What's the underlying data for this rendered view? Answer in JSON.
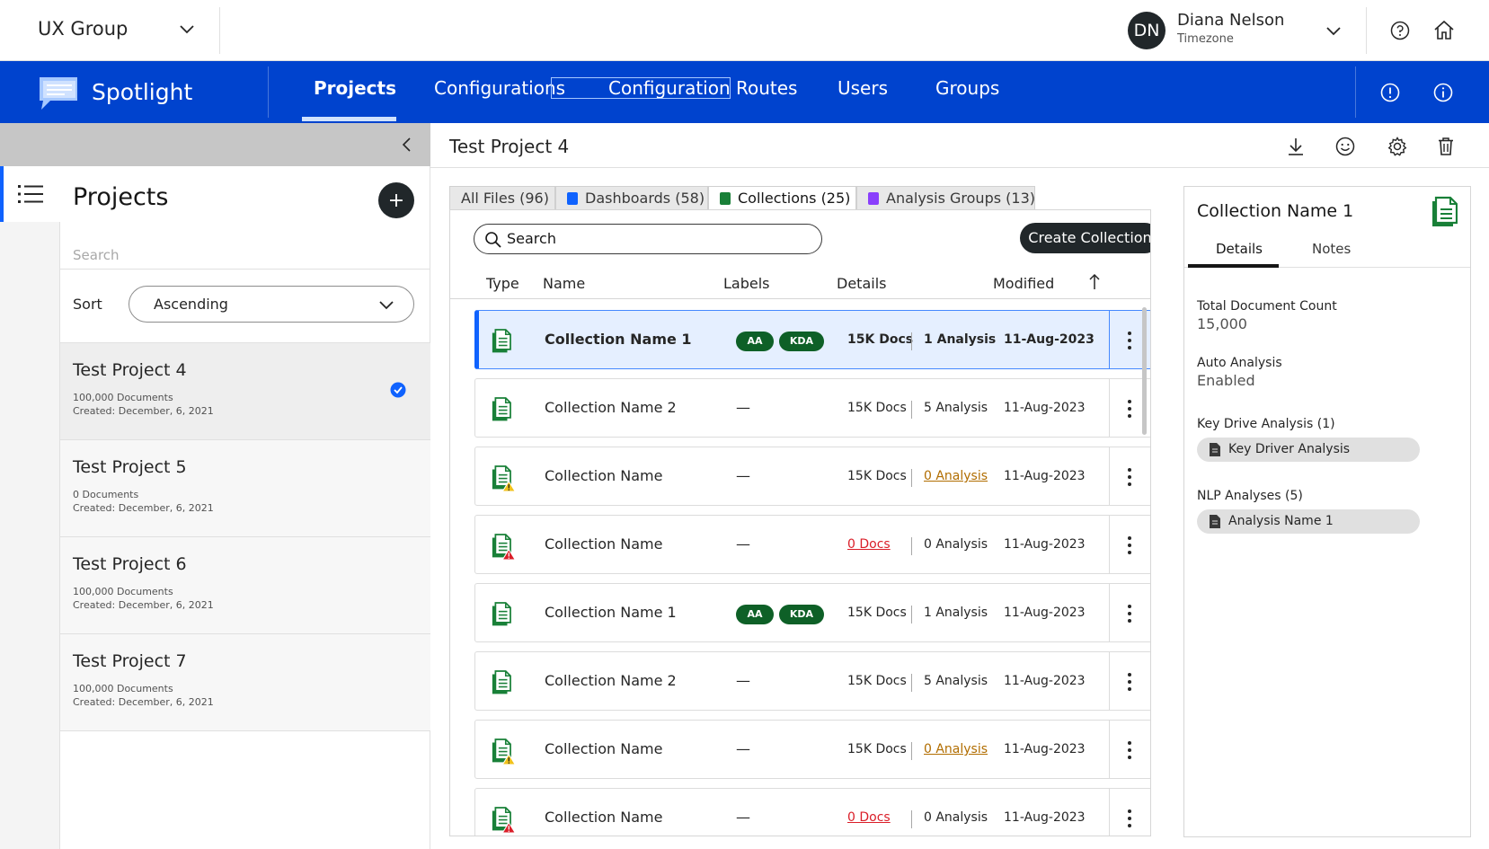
{
  "header": {
    "org_name": "UX Group",
    "user": {
      "initials": "DN",
      "name": "Diana Nelson",
      "subtitle": "Timezone"
    }
  },
  "nav": {
    "brand": "Spotlight",
    "items": [
      {
        "label": "Projects",
        "active": true
      },
      {
        "label": "Configurations"
      },
      {
        "label": "Configuration Routes"
      },
      {
        "label": "Users"
      },
      {
        "label": "Groups"
      }
    ]
  },
  "projects_panel": {
    "title": "Projects",
    "add_label": "+",
    "search_placeholder": "Search",
    "sort_label": "Sort",
    "sort_value": "Ascending",
    "items": [
      {
        "name": "Test Project 4",
        "docs": "100,000 Documents",
        "created": "Created: December, 6, 2021",
        "selected": true
      },
      {
        "name": "Test Project 5",
        "docs": "0 Documents",
        "created": "Created: December, 6, 2021"
      },
      {
        "name": "Test Project 6",
        "docs": "100,000 Documents",
        "created": "Created: December, 6, 2021"
      },
      {
        "name": "Test Project 7",
        "docs": "100,000 Documents",
        "created": "Created: December, 6, 2021"
      }
    ]
  },
  "main": {
    "title": "Test Project 4",
    "tabs": [
      {
        "label": "All Files (96)"
      },
      {
        "label": "Dashboards (58)"
      },
      {
        "label": "Collections (25)",
        "active": true
      },
      {
        "label": "Analysis Groups (13)"
      }
    ],
    "search_placeholder": "Search",
    "create_button": "Create Collection",
    "columns": [
      "Type",
      "Name",
      "Labels",
      "Details",
      "Modified"
    ],
    "rows": [
      {
        "name": "Collection Name 1",
        "labels": [
          "AA",
          "KDA"
        ],
        "docs": "15K Docs",
        "analysis": "1 Analysis",
        "date": "11-Aug-2023",
        "status": "ok",
        "selected": true
      },
      {
        "name": "Collection Name 2",
        "labels_text": "—",
        "docs": "15K Docs",
        "analysis": "5 Analysis",
        "date": "11-Aug-2023",
        "status": "ok"
      },
      {
        "name": "Collection Name",
        "labels_text": "—",
        "docs": "15K Docs",
        "analysis": "0 Analysis",
        "date": "11-Aug-2023",
        "status": "warning"
      },
      {
        "name": "Collection Name",
        "labels_text": "—",
        "docs": "0 Docs",
        "analysis": "0 Analysis",
        "date": "11-Aug-2023",
        "status": "error"
      },
      {
        "name": "Collection Name 1",
        "labels": [
          "AA",
          "KDA"
        ],
        "docs": "15K Docs",
        "analysis": "1 Analysis",
        "date": "11-Aug-2023",
        "status": "ok"
      },
      {
        "name": "Collection Name 2",
        "labels_text": "—",
        "docs": "15K Docs",
        "analysis": "5 Analysis",
        "date": "11-Aug-2023",
        "status": "ok"
      },
      {
        "name": "Collection Name",
        "labels_text": "—",
        "docs": "15K Docs",
        "analysis": "0 Analysis",
        "date": "11-Aug-2023",
        "status": "warning"
      },
      {
        "name": "Collection Name",
        "labels_text": "—",
        "docs": "0 Docs",
        "analysis": "0 Analysis",
        "date": "11-Aug-2023",
        "status": "error"
      }
    ]
  },
  "details": {
    "title": "Collection Name 1",
    "tabs": [
      "Details",
      "Notes"
    ],
    "total_doc_label": "Total Document Count",
    "total_doc_value": "15,000",
    "auto_analysis_label": "Auto Analysis",
    "auto_analysis_value": "Enabled",
    "kda_label": "Key Drive Analysis (1)",
    "kda_chip": "Key Driver Analysis",
    "nlp_label": "NLP Analyses (5)",
    "nlp_chip": "Analysis Name 1"
  },
  "colors": {
    "nav_blue": "#0043ce",
    "doc_green": "#198038",
    "badge_green": "#0e6027",
    "warning": "#f1c21b",
    "error": "#da1e28",
    "dark_button": "#21272a"
  }
}
